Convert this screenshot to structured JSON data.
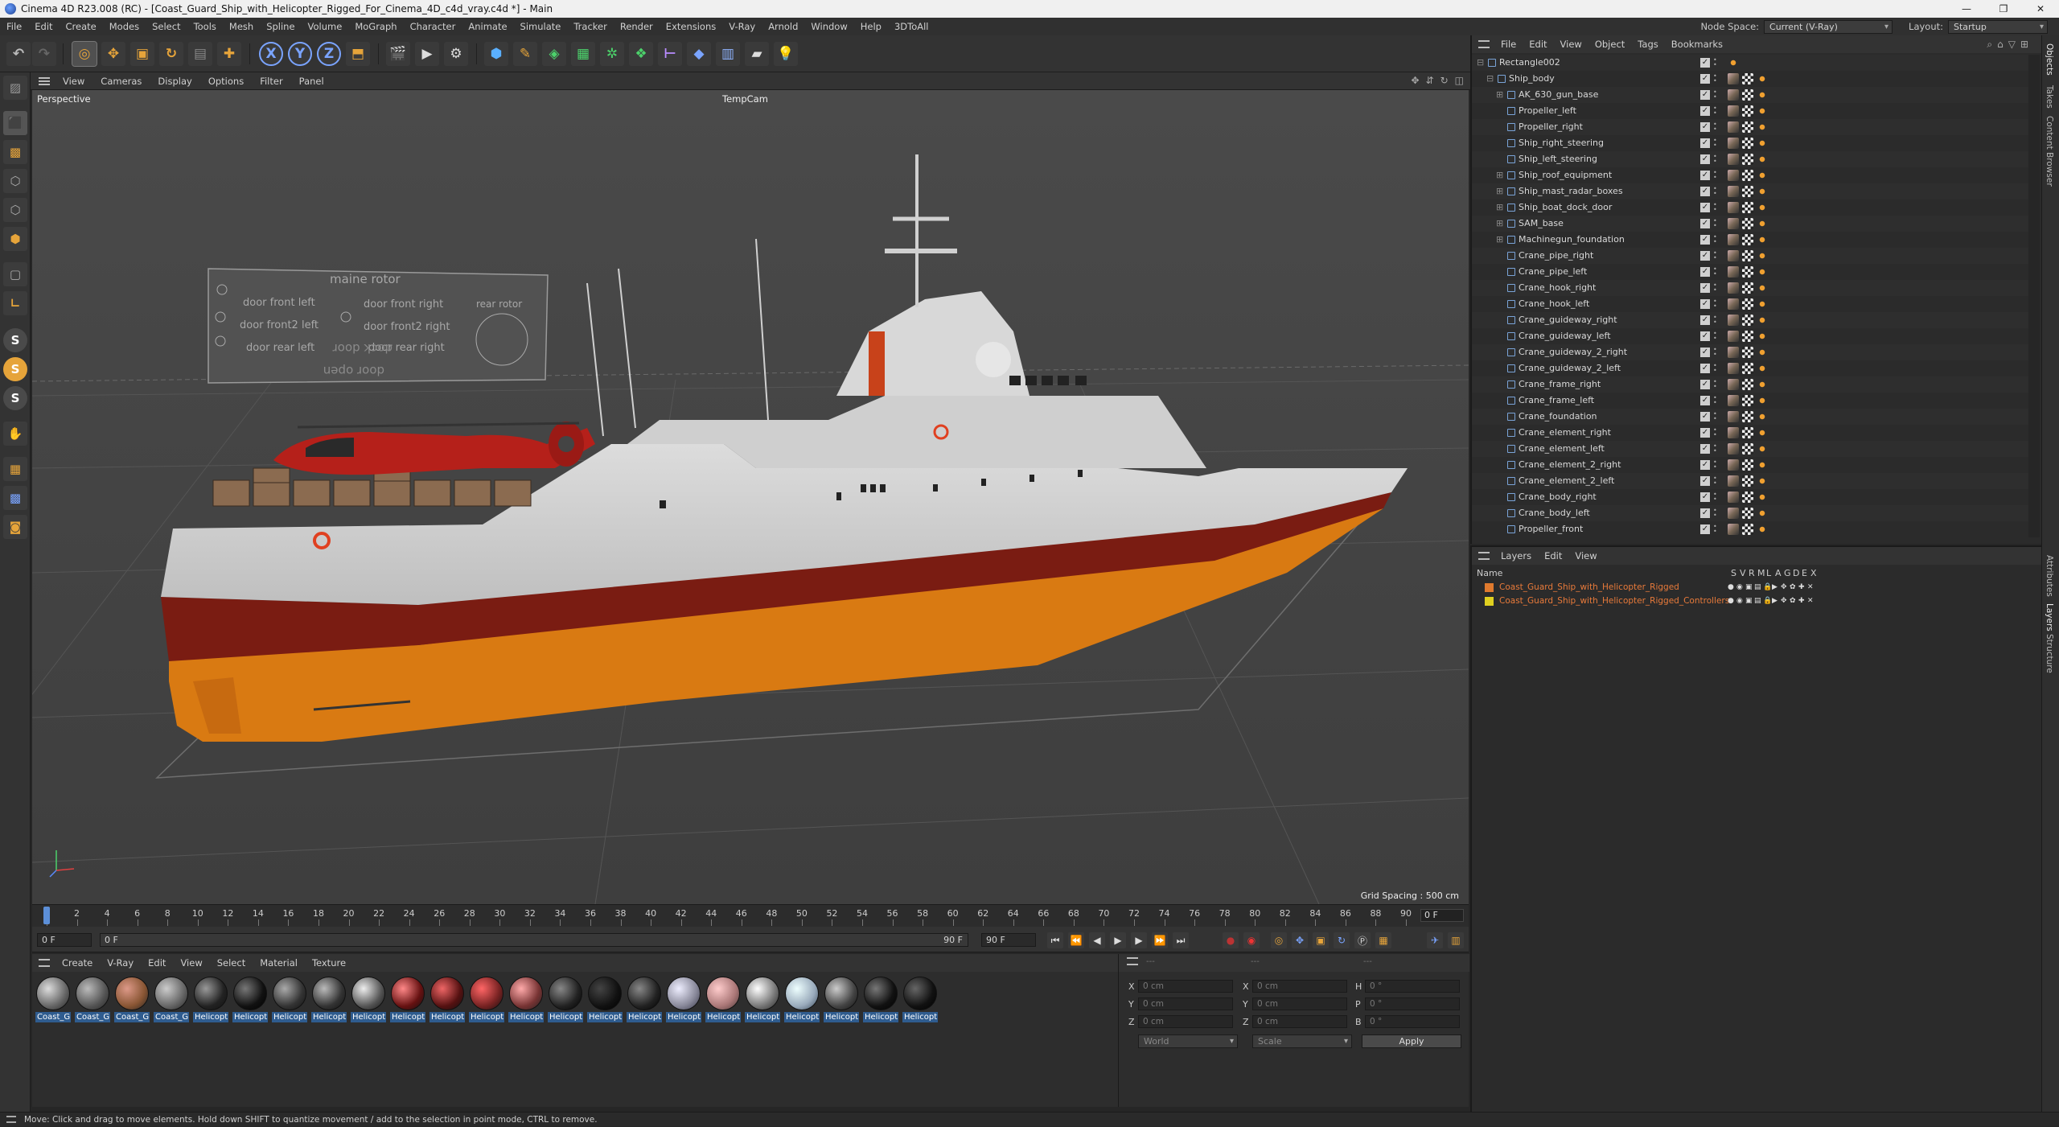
{
  "window": {
    "title": "Cinema 4D R23.008 (RC) - [Coast_Guard_Ship_with_Helicopter_Rigged_For_Cinema_4D_c4d_vray.c4d *] - Main"
  },
  "menubar": {
    "items": [
      "File",
      "Edit",
      "Create",
      "Modes",
      "Select",
      "Tools",
      "Mesh",
      "Spline",
      "Volume",
      "MoGraph",
      "Character",
      "Animate",
      "Simulate",
      "Tracker",
      "Render",
      "Extensions",
      "V-Ray",
      "Arnold",
      "Window",
      "Help",
      "3DToAll"
    ],
    "node_space_label": "Node Space:",
    "node_space_value": "Current (V-Ray)",
    "layout_label": "Layout:",
    "layout_value": "Startup"
  },
  "toolbar": {
    "axis_x": "X",
    "axis_y": "Y",
    "axis_z": "Z"
  },
  "viewport": {
    "menu": [
      "View",
      "Cameras",
      "Display",
      "Options",
      "Filter",
      "Panel"
    ],
    "label": "Perspective",
    "camera": "TempCam",
    "grid_spacing": "Grid Spacing : 500 cm",
    "rig_labels": [
      "maine rotor",
      "door front left",
      "door front right",
      "rear rotor",
      "door front2 left",
      "door front2 right",
      "door rear left",
      "door rear right",
      "dock door",
      "door open"
    ]
  },
  "timeline": {
    "ticks": [
      "0",
      "2",
      "4",
      "6",
      "8",
      "10",
      "12",
      "14",
      "16",
      "18",
      "20",
      "22",
      "24",
      "26",
      "28",
      "30",
      "32",
      "34",
      "36",
      "38",
      "40",
      "42",
      "44",
      "46",
      "48",
      "50",
      "52",
      "54",
      "56",
      "58",
      "60",
      "62",
      "64",
      "66",
      "68",
      "70",
      "72",
      "74",
      "76",
      "78",
      "80",
      "82",
      "84",
      "86",
      "88",
      "90"
    ],
    "current": "0 F"
  },
  "playbar": {
    "start": "0 F",
    "range_start": "0 F",
    "range_end": "90 F",
    "end": "90 F"
  },
  "materials": {
    "menu": [
      "Create",
      "V-Ray",
      "Edit",
      "View",
      "Select",
      "Material",
      "Texture"
    ],
    "items": [
      "Coast_G",
      "Coast_G",
      "Coast_G",
      "Coast_G",
      "Helicopt",
      "Helicopt",
      "Helicopt",
      "Helicopt",
      "Helicopt",
      "Helicopt",
      "Helicopt",
      "Helicopt",
      "Helicopt",
      "Helicopt",
      "Helicopt",
      "Helicopt",
      "Helicopt",
      "Helicopt",
      "Helicopt",
      "Helicopt",
      "Helicopt",
      "Helicopt",
      "Helicopt"
    ]
  },
  "attributes": {
    "x": "X",
    "y": "Y",
    "z": "Z",
    "h": "H",
    "p": "P",
    "b": "B",
    "pos_x": "0 cm",
    "pos_y": "0 cm",
    "pos_z": "0 cm",
    "size_x": "0 cm",
    "size_y": "0 cm",
    "size_z": "0 cm",
    "rot_h": "0 °",
    "rot_p": "0 °",
    "rot_b": "0 °",
    "coord_mode": "World",
    "size_mode": "Scale",
    "apply": "Apply",
    "header_left": "---",
    "header_mid": "---",
    "header_right": "---"
  },
  "objects": {
    "menu": [
      "File",
      "Edit",
      "View",
      "Object",
      "Tags",
      "Bookmarks"
    ],
    "rows": [
      {
        "name": "Rectangle002",
        "depth": 0
      },
      {
        "name": "Ship_body",
        "depth": 1
      },
      {
        "name": "AK_630_gun_base",
        "depth": 2
      },
      {
        "name": "Propeller_left",
        "depth": 2
      },
      {
        "name": "Propeller_right",
        "depth": 2
      },
      {
        "name": "Ship_right_steering",
        "depth": 2
      },
      {
        "name": "Ship_left_steering",
        "depth": 2
      },
      {
        "name": "Ship_roof_equipment",
        "depth": 2
      },
      {
        "name": "Ship_mast_radar_boxes",
        "depth": 2
      },
      {
        "name": "Ship_boat_dock_door",
        "depth": 2
      },
      {
        "name": "SAM_base",
        "depth": 2
      },
      {
        "name": "Machinegun_foundation",
        "depth": 2
      },
      {
        "name": "Crane_pipe_right",
        "depth": 2
      },
      {
        "name": "Crane_pipe_left",
        "depth": 2
      },
      {
        "name": "Crane_hook_right",
        "depth": 2
      },
      {
        "name": "Crane_hook_left",
        "depth": 2
      },
      {
        "name": "Crane_guideway_right",
        "depth": 2
      },
      {
        "name": "Crane_guideway_left",
        "depth": 2
      },
      {
        "name": "Crane_guideway_2_right",
        "depth": 2
      },
      {
        "name": "Crane_guideway_2_left",
        "depth": 2
      },
      {
        "name": "Crane_frame_right",
        "depth": 2
      },
      {
        "name": "Crane_frame_left",
        "depth": 2
      },
      {
        "name": "Crane_foundation",
        "depth": 2
      },
      {
        "name": "Crane_element_right",
        "depth": 2
      },
      {
        "name": "Crane_element_left",
        "depth": 2
      },
      {
        "name": "Crane_element_2_right",
        "depth": 2
      },
      {
        "name": "Crane_element_2_left",
        "depth": 2
      },
      {
        "name": "Crane_body_right",
        "depth": 2
      },
      {
        "name": "Crane_body_left",
        "depth": 2
      },
      {
        "name": "Propeller_front",
        "depth": 2
      }
    ]
  },
  "layers": {
    "menu": [
      "Layers",
      "Edit",
      "View"
    ],
    "header_name": "Name",
    "header_cols": [
      "S",
      "V",
      "R",
      "M",
      "L",
      "A",
      "G",
      "D",
      "E",
      "X"
    ],
    "rows": [
      {
        "name": "Coast_Guard_Ship_with_Helicopter_Rigged",
        "color": "#e07a2e"
      },
      {
        "name": "Coast_Guard_Ship_with_Helicopter_Rigged_Controllers",
        "color": "#e0d020"
      }
    ]
  },
  "right_tabs": [
    "Objects",
    "Takes",
    "Content Browser",
    "Attributes",
    "Layers",
    "Structure"
  ],
  "status": "Move: Click and drag to move elements. Hold down SHIFT to quantize movement / add to the selection in point mode, CTRL to remove."
}
